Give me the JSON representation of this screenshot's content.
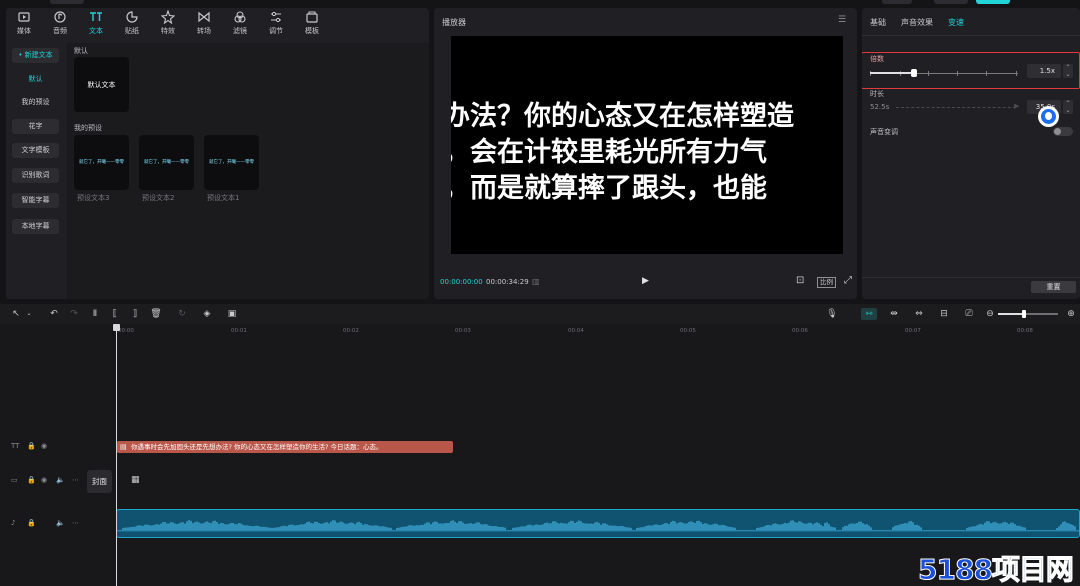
{
  "left_panel": {
    "toolbar": [
      {
        "label": "媒体",
        "icon": "media-icon"
      },
      {
        "label": "音频",
        "icon": "audio-icon"
      },
      {
        "label": "文本",
        "icon": "text-icon",
        "active": true
      },
      {
        "label": "贴纸",
        "icon": "sticker-icon"
      },
      {
        "label": "特效",
        "icon": "effects-icon"
      },
      {
        "label": "转场",
        "icon": "transition-icon"
      },
      {
        "label": "滤镜",
        "icon": "filter-icon"
      },
      {
        "label": "调节",
        "icon": "adjust-icon"
      },
      {
        "label": "模板",
        "icon": "template-icon"
      }
    ],
    "side_nav": [
      "• 新建文本",
      "默认",
      "我的预设",
      "花字",
      "文字模板",
      "识别歌词",
      "智能字幕",
      "本地字幕"
    ],
    "default_section": {
      "title": "默认",
      "card_label": "默认文本"
    },
    "preset_section": {
      "title": "我的预设",
      "cards": [
        {
          "preview": "就它了，开曦——零零",
          "caption": "预设文本3"
        },
        {
          "preview": "就它了，开曦——零零",
          "caption": "预设文本2"
        },
        {
          "preview": "就它了，开曦——零零",
          "caption": "预设文本1"
        }
      ]
    }
  },
  "player": {
    "title": "播放器",
    "subtitle_lines": [
      "办法？你的心态又在怎样塑造",
      "，会在计较里耗光所有力气",
      "，而是就算摔了跟头，也能"
    ],
    "current_time": "00:00:00:00",
    "total_time": "00:00:34:29",
    "ratio_label": "比例"
  },
  "right_panel": {
    "tabs": [
      "基础",
      "声音效果",
      "变速"
    ],
    "active_tab": "变速",
    "speed": {
      "label": "倍数",
      "value": "1.5x",
      "fraction": 0.3
    },
    "duration": {
      "label": "时长",
      "left_value": "52.5s",
      "right_value": "35.0s"
    },
    "pitch": {
      "label": "声音变调"
    },
    "reset_label": "重置"
  },
  "timeline": {
    "ruler_ticks": [
      "00:00",
      "00:01",
      "00:02",
      "00:03",
      "00:04",
      "00:05",
      "00:06",
      "00:07",
      "00:08"
    ],
    "text_clip": "你遇事时会先加固头还是先想办法? 你的心态又在怎样塑造你的生活? 今日话题：心态。",
    "cover_label": "封面"
  },
  "watermark": "5188项目网",
  "colors": {
    "accent": "#20d4d7",
    "highlight": "#e03a3a",
    "text_clip": "#b9574a",
    "audio_clip": "#0f5370"
  }
}
